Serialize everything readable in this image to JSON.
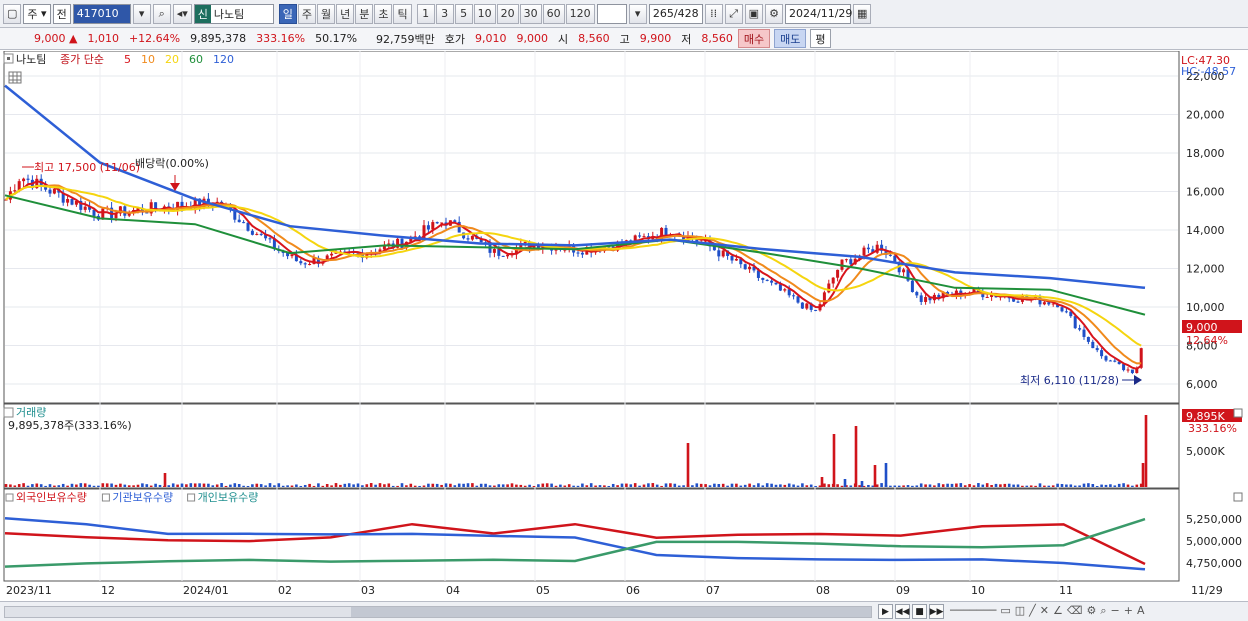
{
  "toolbar": {
    "type_select": "주",
    "market_select": "전",
    "code": "417010",
    "stock_badge": "신",
    "stock_name": "나노팀",
    "periods": [
      "일",
      "주",
      "월",
      "년",
      "분",
      "초",
      "틱"
    ],
    "selected_period": "일",
    "intervals": [
      "1",
      "3",
      "5",
      "10",
      "20",
      "30",
      "60",
      "120"
    ],
    "count": "265",
    "total": "/428",
    "date": "2024/11/29"
  },
  "quote": {
    "price": "9,000",
    "change": "1,010",
    "change_pct": "+12.64%",
    "volume": "9,895,378",
    "vol_ratio": "333.16%",
    "turnover": "50.17%",
    "amount": "92,759백만",
    "ask_label": "호가",
    "ask1": "9,010",
    "ask2": "9,000",
    "open_label": "시",
    "open": "8,560",
    "high_label": "고",
    "high": "9,900",
    "low_label": "저",
    "low": "8,560",
    "buy": "매수",
    "sell": "매도",
    "eval": "평"
  },
  "legend": {
    "name": "나노팀",
    "ma_label": "종가 단순",
    "ma_periods": [
      "5",
      "10",
      "20",
      "60",
      "120"
    ],
    "ma_colors": [
      "#d8141c",
      "#f08a1c",
      "#f5d50f",
      "#1f8f3a",
      "#2e5fd6"
    ]
  },
  "annotations": {
    "high": "최고 17,500 (11/06)",
    "dividend": "배당락(0.00%)",
    "low": "최저 6,110 (11/28)",
    "lc": "LC:47.30",
    "hc": "HC:-48.57",
    "price_tag": "9,000",
    "pct_tag": "12.64%"
  },
  "volume_panel": {
    "title": "거래량",
    "value": "9,895,378주(333.16%)",
    "tag": "9,895K",
    "tag_pct": "333.16%",
    "axis_label": "5,000K"
  },
  "holding_panel": {
    "labels": [
      "외국인보유수량",
      "기관보유수량",
      "개인보유수량"
    ],
    "axis_labels": [
      "5,250,000",
      "5,000,000",
      "4,750,000"
    ]
  },
  "chart_data": {
    "type": "candlestick",
    "y_ticks": [
      "22,000",
      "20,000",
      "18,000",
      "16,000",
      "14,000",
      "12,000",
      "10,000",
      "8,000",
      "6,000"
    ],
    "x_labels": [
      "2023/11",
      "12",
      "2024/01",
      "02",
      "03",
      "04",
      "05",
      "06",
      "07",
      "08",
      "09",
      "10",
      "11",
      "11/29"
    ],
    "close_anchors": [
      {
        "x": "2023/11",
        "v": 15500
      },
      {
        "x": "11/06",
        "v": 16800
      },
      {
        "x": "12",
        "v": 14800
      },
      {
        "x": "2024/01",
        "v": 15300
      },
      {
        "x": "01/20",
        "v": 15400
      },
      {
        "x": "02",
        "v": 13000
      },
      {
        "x": "02/15",
        "v": 12300
      },
      {
        "x": "03",
        "v": 12800
      },
      {
        "x": "03/20",
        "v": 13300
      },
      {
        "x": "04",
        "v": 14500
      },
      {
        "x": "04/20",
        "v": 12800
      },
      {
        "x": "05",
        "v": 13300
      },
      {
        "x": "05/20",
        "v": 13000
      },
      {
        "x": "06",
        "v": 13300
      },
      {
        "x": "06/20",
        "v": 14000
      },
      {
        "x": "07",
        "v": 13300
      },
      {
        "x": "07/20",
        "v": 11500
      },
      {
        "x": "08",
        "v": 9700
      },
      {
        "x": "08/10",
        "v": 12200
      },
      {
        "x": "08/25",
        "v": 13200
      },
      {
        "x": "09",
        "v": 12400
      },
      {
        "x": "09/10",
        "v": 10400
      },
      {
        "x": "10",
        "v": 10800
      },
      {
        "x": "11",
        "v": 10200
      },
      {
        "x": "11/15",
        "v": 7500
      },
      {
        "x": "11/28",
        "v": 6400
      },
      {
        "x": "11/29",
        "v": 9000
      }
    ],
    "ma60": [
      15800,
      14600,
      14300,
      12800,
      13200,
      13100,
      13000,
      13500,
      12800,
      12000,
      11000,
      10900,
      9600
    ],
    "ma120": [
      21500,
      17500,
      15600,
      14200,
      13700,
      13300,
      13200,
      13500,
      13000,
      12600,
      11800,
      11500,
      11000
    ],
    "holdings_foreign": [
      5100000,
      5050000,
      5020000,
      5010000,
      5050000,
      5200000,
      5100000,
      5200000,
      5050000,
      5080000,
      5090000,
      5070000,
      5180000,
      5200000,
      4750000
    ],
    "holdings_inst": [
      5270000,
      5200000,
      5090000,
      5090000,
      5090000,
      5090000,
      5070000,
      5050000,
      4850000,
      4820000,
      4800000,
      4800000,
      4800000,
      4760000,
      4690000
    ],
    "holdings_indiv": [
      4720000,
      4760000,
      4780000,
      4800000,
      4780000,
      4790000,
      4800000,
      4780000,
      5000000,
      5000000,
      4980000,
      4950000,
      4940000,
      4960000,
      5260000
    ]
  }
}
